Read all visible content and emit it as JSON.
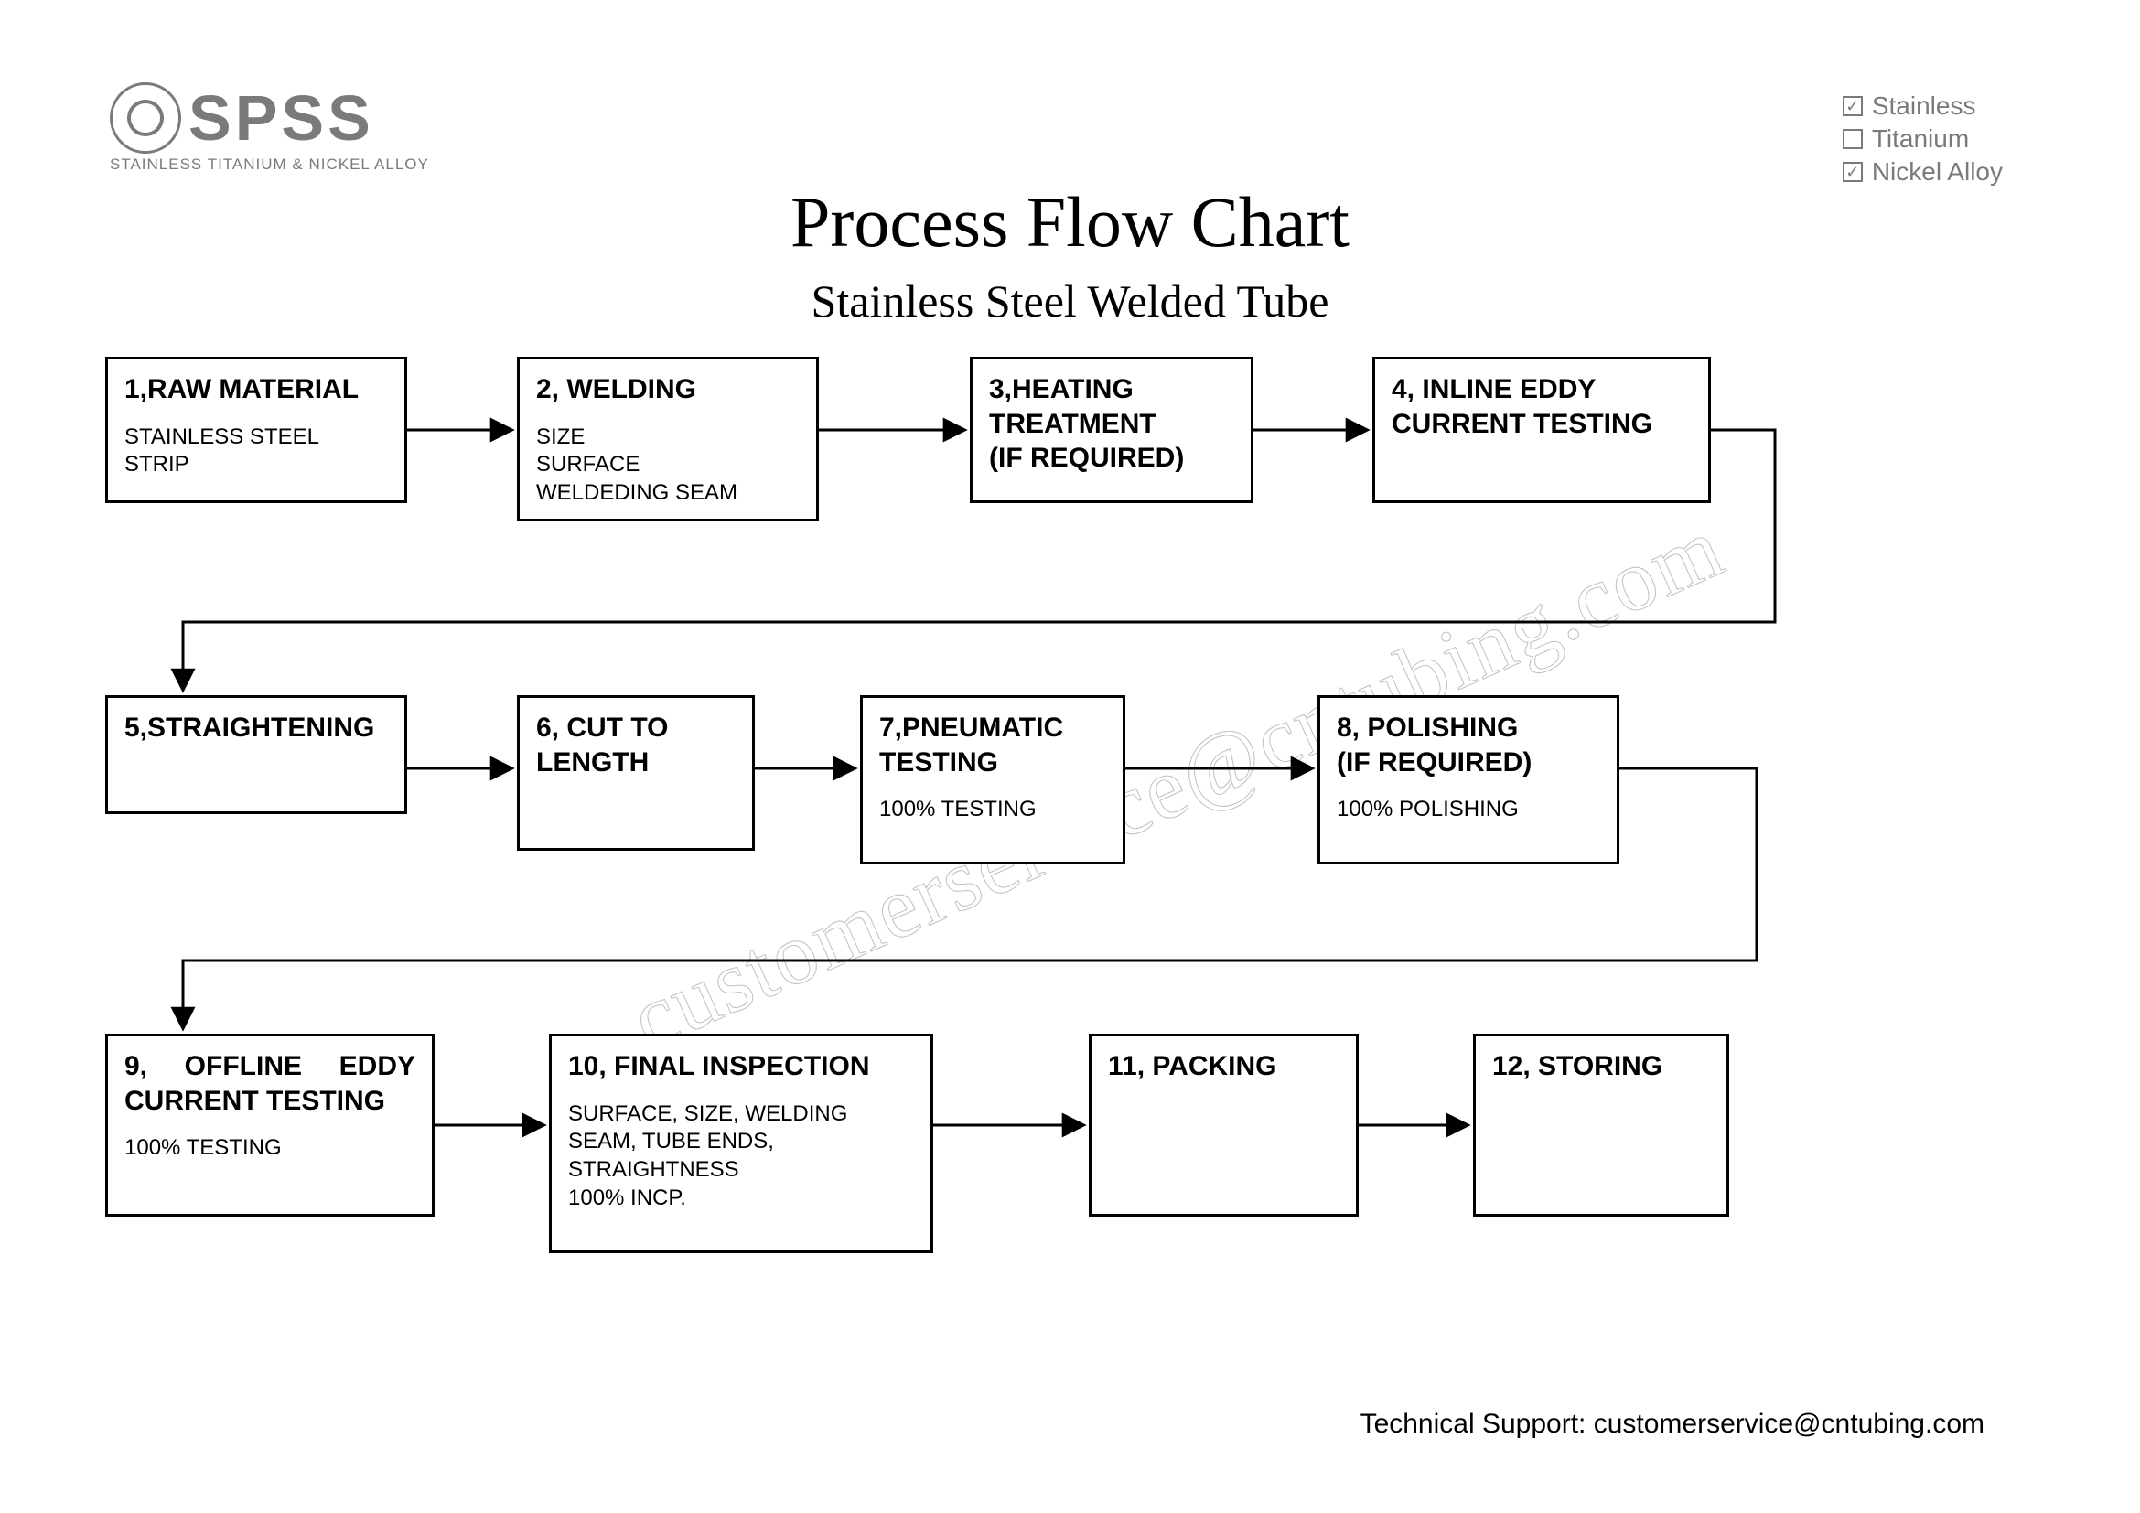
{
  "logo": {
    "name": "SPSS",
    "tagline": "STAINLESS TITANIUM & NICKEL ALLOY"
  },
  "checkboxes": [
    {
      "label": "Stainless",
      "checked": true
    },
    {
      "label": "Titanium",
      "checked": false
    },
    {
      "label": "Nickel Alloy",
      "checked": true
    }
  ],
  "title": "Process Flow Chart",
  "subtitle": "Stainless Steel Welded Tube",
  "boxes": {
    "b1": {
      "title": "1,RAW MATERIAL",
      "detail": "STAINLESS STEEL STRIP"
    },
    "b2": {
      "title": "2, WELDING",
      "detail": "SIZE\nSURFACE\nWELDEDING SEAM"
    },
    "b3": {
      "title": "3,HEATING TREATMENT\n(IF REQUIRED)",
      "detail": ""
    },
    "b4": {
      "title": "4, INLINE EDDY CURRENT TESTING",
      "detail": ""
    },
    "b5": {
      "title": "5,STRAIGHTENING",
      "detail": ""
    },
    "b6": {
      "title": "6, CUT TO LENGTH",
      "detail": ""
    },
    "b7": {
      "title": "7,PNEUMATIC TESTING",
      "detail": "100% TESTING"
    },
    "b8": {
      "title": "8, POLISHING\n(IF REQUIRED)",
      "detail": "100% POLISHING"
    },
    "b9": {
      "title": "9, OFFLINE EDDY CURRENT TESTING",
      "detail": "100% TESTING"
    },
    "b10": {
      "title": "10, FINAL INSPECTION",
      "detail": "SURFACE, SIZE, WELDING SEAM, TUBE ENDS, STRAIGHTNESS\n100% INCP."
    },
    "b11": {
      "title": "11, PACKING",
      "detail": ""
    },
    "b12": {
      "title": "12, STORING",
      "detail": ""
    }
  },
  "watermark": "customerservice@cntubing.com",
  "footer": "Technical Support: customerservice@cntubing.com"
}
